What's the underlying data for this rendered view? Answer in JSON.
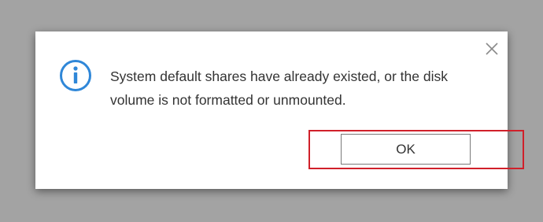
{
  "dialog": {
    "message": "System default shares have already existed, or the disk volume is not formatted or unmounted.",
    "ok_label": "OK",
    "info_icon": "info-icon",
    "close_icon": "close-icon"
  },
  "colors": {
    "backdrop": "#a3a3a3",
    "dialog_background": "#ffffff",
    "info_icon": "#2f87d8",
    "highlight": "#d0202a",
    "text": "#333333"
  }
}
